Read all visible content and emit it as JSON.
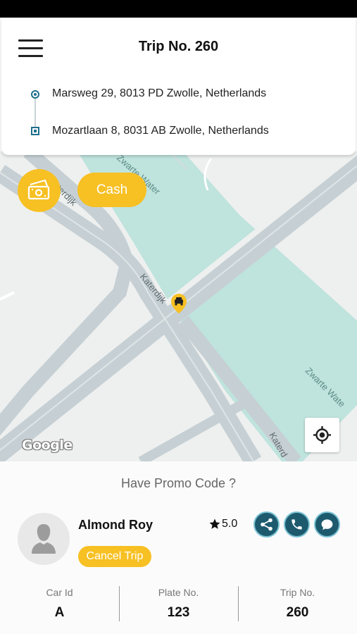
{
  "header": {
    "title": "Trip No. 260",
    "pickup_address": "Marsweg 29, 8013 PD Zwolle, Netherlands",
    "dropoff_address": "Mozartlaan 8, 8031 AB Zwolle, Netherlands"
  },
  "map": {
    "street_labels": [
      "Katerdijk",
      "Katerdijk",
      "Katerd",
      "Zwarte Water",
      "Zwarte Wate"
    ],
    "attribution": "Google",
    "payment_method": "Cash"
  },
  "trip_panel": {
    "promo_text": "Have Promo Code ?",
    "driver_name": "Almond Roy",
    "rating": "5.0",
    "cancel_label": "Cancel Trip",
    "stats": [
      {
        "label": "Car Id",
        "value": "A"
      },
      {
        "label": "Plate No.",
        "value": "123"
      },
      {
        "label": "Trip No.",
        "value": "260"
      }
    ]
  },
  "icons": {
    "menu": "hamburger-menu-icon",
    "cash": "cash-icon",
    "locate": "my-location-icon",
    "taxi": "taxi-marker-icon",
    "share": "share-icon",
    "call": "phone-icon",
    "chat": "chat-icon",
    "star": "star-icon",
    "avatar": "person-icon"
  },
  "colors": {
    "accent": "#f7c023",
    "primary": "#1d5a6e",
    "water": "#bfe3dd",
    "road": "#c6d0d4"
  }
}
